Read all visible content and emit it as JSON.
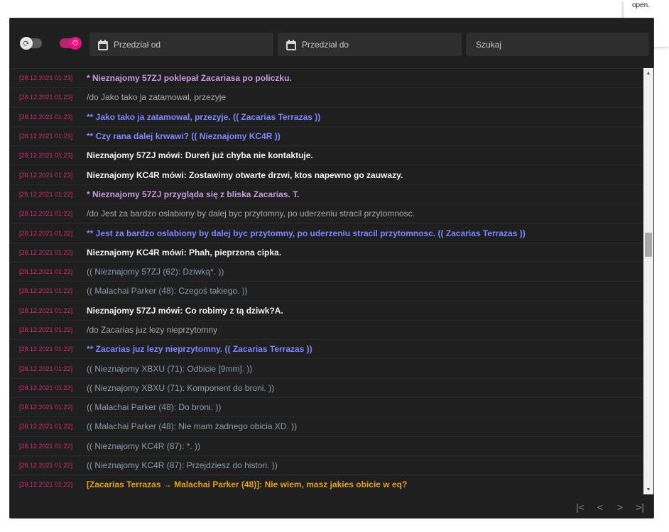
{
  "popover": {
    "text": "open."
  },
  "toolbar": {
    "refresh_toggle_icon": "refresh-icon",
    "timer_toggle_icon": "timer-icon",
    "date_from_placeholder": "Przedział od",
    "date_to_placeholder": "Przedział do",
    "search_placeholder": "Szukaj"
  },
  "colors": {
    "accent": "#e8127f",
    "timestamp": "#d42a6b",
    "background": "#1f1f1f"
  },
  "messages": [
    {
      "ts": "[28.12.2021 01:23]",
      "text": "* Nieznajomy 57ZJ poklepał Zacariasa po policzku.",
      "type": "me"
    },
    {
      "ts": "[28.12.2021 01:23]",
      "text": "/do Jako tako ja zatamowal, przezyje",
      "type": "do"
    },
    {
      "ts": "[28.12.2021 01:23]",
      "text": "** Jako tako ja zatamowal, przezyje. (( Zacarias Terrazas ))",
      "type": "doresp"
    },
    {
      "ts": "[28.12.2021 01:23]",
      "text": "** Czy rana dalej krwawi? (( Nieznajomy KC4R ))",
      "type": "doresp"
    },
    {
      "ts": "[28.12.2021 01:23]",
      "text": "Nieznajomy 57ZJ mówi: Dureń już chyba nie kontaktuje.",
      "type": "say"
    },
    {
      "ts": "[28.12.2021 01:23]",
      "text": "Nieznajomy KC4R mówi: Zostawimy otwarte drzwi, ktos napewno go zauwazy.",
      "type": "say"
    },
    {
      "ts": "[28.12.2021 01:22]",
      "text": "* Nieznajomy 57ZJ przygląda się z bliska Zacarias. T.",
      "type": "me"
    },
    {
      "ts": "[28.12.2021 01:22]",
      "text": "/do Jest za bardzo oslabiony by dalej byc przytomny, po uderzeniu stracil przytomnosc.",
      "type": "do"
    },
    {
      "ts": "[28.12.2021 01:22]",
      "text": "** Jest za bardzo oslabiony by dalej byc przytomny, po uderzeniu stracil przytomnosc. (( Zacarias Terrazas ))",
      "type": "doresp"
    },
    {
      "ts": "[28.12.2021 01:22]",
      "text": "Nieznajomy KC4R mówi: Phah, pieprzona cipka.",
      "type": "say"
    },
    {
      "ts": "[28.12.2021 01:22]",
      "text": "(( Nieznajomy 57ZJ (62): Dziwką*. ))",
      "type": "ooc"
    },
    {
      "ts": "[28.12.2021 01:22]",
      "text": "(( Malachai Parker (48): Czegoś takiego. ))",
      "type": "ooc"
    },
    {
      "ts": "[28.12.2021 01:22]",
      "text": "Nieznajomy 57ZJ mówi: Co robimy z tą dziwk?A.",
      "type": "say"
    },
    {
      "ts": "[28.12.2021 01:22]",
      "text": "/do Zacarias juz lezy nieprzytomny",
      "type": "do"
    },
    {
      "ts": "[28.12.2021 01:22]",
      "text": "** Zacarias juz lezy nieprzytomny. (( Zacarias Terrazas ))",
      "type": "doresp"
    },
    {
      "ts": "[28.12.2021 01:22]",
      "text": "(( Nieznajomy XBXU (71): Odbicie [9mm]. ))",
      "type": "ooc"
    },
    {
      "ts": "[28.12.2021 01:22]",
      "text": "(( Nieznajomy XBXU (71): Komponent do broni. ))",
      "type": "ooc"
    },
    {
      "ts": "[28.12.2021 01:22]",
      "text": "(( Malachai Parker (48): Do broni. ))",
      "type": "ooc"
    },
    {
      "ts": "[28.12.2021 01:22]",
      "text": "(( Malachai Parker (48): Nie mam żadnego obicia XD. ))",
      "type": "ooc"
    },
    {
      "ts": "[28.12.2021 01:22]",
      "text": "(( Nieznajomy KC4R (87): *. ))",
      "type": "ooc"
    },
    {
      "ts": "[28.12.2021 01:22]",
      "text": "(( Nieznajomy KC4R (87): Przejdziesz do histori. ))",
      "type": "ooc"
    },
    {
      "ts": "[28.12.2021 01:22]",
      "text": "[Zacarias Terrazas → Malachai Parker (48)]: Nie wiem, masz jakies obicie w eq?",
      "type": "pm"
    }
  ],
  "pager": {
    "first": "|<",
    "prev": "<",
    "next": ">",
    "last": ">|"
  }
}
